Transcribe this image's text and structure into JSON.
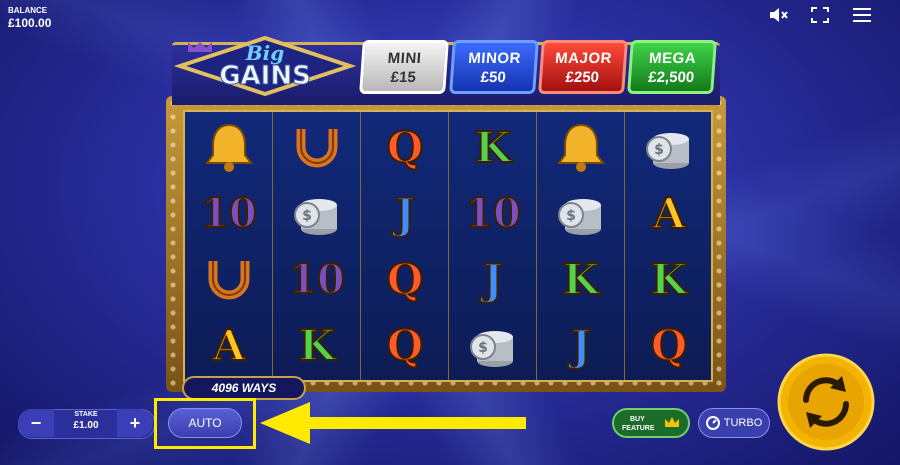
{
  "balance": {
    "label": "BALANCE",
    "value": "£100.00"
  },
  "top_icons": [
    "mute-icon",
    "fullscreen-icon",
    "menu-icon"
  ],
  "logo": {
    "line1": "Big",
    "line2": "GAINS"
  },
  "jackpots": [
    {
      "name": "MINI",
      "value": "£15"
    },
    {
      "name": "MINOR",
      "value": "£50"
    },
    {
      "name": "MAJOR",
      "value": "£250"
    },
    {
      "name": "MEGA",
      "value": "£2,500"
    }
  ],
  "reels": [
    [
      "bell",
      "10",
      "horseshoe",
      "A"
    ],
    [
      "horseshoe",
      "coins",
      "10",
      "K"
    ],
    [
      "Q",
      "J",
      "Q",
      "Q"
    ],
    [
      "K",
      "10",
      "J",
      "coins"
    ],
    [
      "bell",
      "coins",
      "K",
      "J"
    ],
    [
      "coins",
      "A",
      "K",
      "Q"
    ]
  ],
  "ways": "4096 WAYS",
  "controls": {
    "minus": "−",
    "plus": "+",
    "stake_label": "STAKE",
    "stake_value": "£1.00",
    "auto": "AUTO",
    "buy_feature_line1": "BUY",
    "buy_feature_line2": "FEATURE",
    "turbo": "TURBO"
  },
  "colors": {
    "highlight": "#ffea00",
    "spin": "#f2b400"
  }
}
